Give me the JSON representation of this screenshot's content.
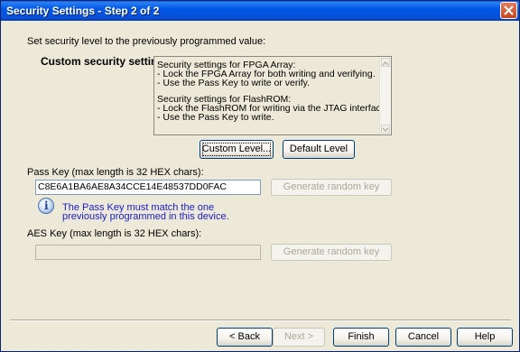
{
  "window": {
    "title": "Security Settings - Step 2 of 2"
  },
  "intro": "Set security level to the previously programmed value:",
  "custom_heading": "Custom security settings",
  "description_lines": [
    "Security settings for FPGA Array:",
    "- Lock the FPGA Array for both writing and verifying.",
    "- Use the Pass Key to write or verify.",
    "",
    "Security settings for FlashROM:",
    "- Lock the FlashROM for writing via the JTAG interface.",
    "- Use the Pass Key to write."
  ],
  "buttons": {
    "custom_level": "Custom Level...",
    "default_level": "Default Level",
    "generate_random_key": "Generate random key",
    "back": "< Back",
    "next": "Next >",
    "finish": "Finish",
    "cancel": "Cancel",
    "help": "Help"
  },
  "pass_key": {
    "label": "Pass Key (max length is 32 HEX chars):",
    "value": "C8E6A1BA6AE8A34CCE14E48537DD0FAC"
  },
  "info_note": {
    "line1": "The Pass Key must match the one",
    "line2": "previously programmed in this device."
  },
  "aes_key": {
    "label": "AES Key (max length is 32 HEX chars):",
    "value": ""
  },
  "colors": {
    "title_bar": "#0058e6",
    "note_text": "#1a1acc",
    "dialog_bg": "#ece9d8"
  }
}
